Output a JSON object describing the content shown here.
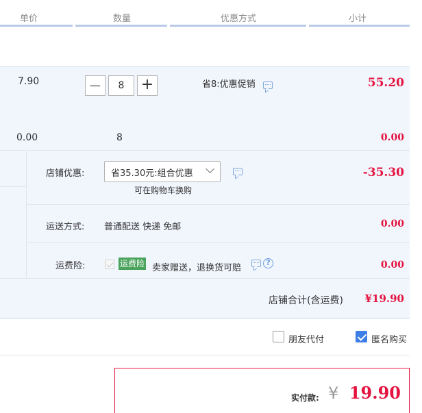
{
  "header": {
    "unit_price": "单价",
    "quantity": "数量",
    "discount_method": "优惠方式",
    "subtotal": "小计"
  },
  "item": {
    "price": "7.90",
    "qty": "8",
    "promo": "省8:优惠促销",
    "subtotal": "55.20",
    "minus": "—",
    "plus": "+"
  },
  "gift_row": {
    "price": "0.00",
    "qty": "8",
    "subtotal": "0.00"
  },
  "store_discount": {
    "label": "店铺优惠:",
    "selected": "省35.30元:组合优惠",
    "note": "可在购物车换购",
    "amount": "-35.30"
  },
  "shipping": {
    "label": "运送方式:",
    "value": "普通配送 快递 免邮",
    "amount": "0.00"
  },
  "insurance": {
    "label": "运费险:",
    "badge": "运费险",
    "desc": "卖家赠送，退换货可赔",
    "help": "?",
    "amount": "0.00"
  },
  "store_total": {
    "label": "店铺合计(含运费)",
    "amount": "¥19.90"
  },
  "options": {
    "friend_pay": "朋友代付",
    "anonymous": "匿名购买"
  },
  "pay": {
    "label": "实付款:",
    "currency": "¥",
    "amount": "19.90"
  },
  "colors": {
    "accent_red": "#e4133f",
    "header_line": "#b8c9e6",
    "zone_bg": "#f1f5fc",
    "badge_green": "#4aa35b",
    "check_blue": "#3d7fe6"
  }
}
